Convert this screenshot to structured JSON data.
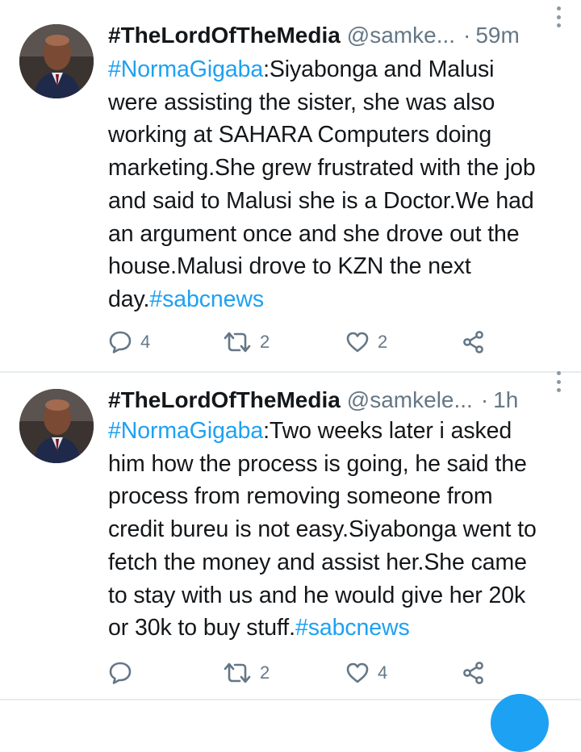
{
  "tweets": [
    {
      "name": "#TheLordOfTheMedia",
      "handle": "@samke...",
      "separator": "·",
      "time": "59m",
      "lines": [
        [
          {
            "t": "#NormaGigaba",
            "h": true
          },
          {
            "t": ":Siyabonga and Malusi",
            "h": false
          }
        ],
        [
          {
            "t": "were assisting the sister, she was also",
            "h": false
          }
        ],
        [
          {
            "t": "working at SAHARA Computers doing",
            "h": false
          }
        ],
        [
          {
            "t": "marketing.She grew frustrated with the job",
            "h": false
          }
        ],
        [
          {
            "t": "and said to Malusi she is a Doctor.We had",
            "h": false
          }
        ],
        [
          {
            "t": "an argument once and she drove out the",
            "h": false
          }
        ],
        [
          {
            "t": "house.Malusi drove to KZN the next",
            "h": false
          }
        ],
        [
          {
            "t": "day.",
            "h": false
          },
          {
            "t": "#sabcnews",
            "h": true
          }
        ]
      ],
      "reply_count": "4",
      "retweet_count": "2",
      "like_count": "2"
    },
    {
      "name": "#TheLordOfTheMedia",
      "handle": "@samkele...",
      "separator": "·",
      "time": "1h",
      "lines": [
        [
          {
            "t": "#NormaGigaba",
            "h": true
          },
          {
            "t": ":Two weeks later i asked",
            "h": false
          }
        ],
        [
          {
            "t": "him how the process is going, he said the",
            "h": false
          }
        ],
        [
          {
            "t": "process from removing someone from",
            "h": false
          }
        ],
        [
          {
            "t": "credit bureu is not easy.Siyabonga went to",
            "h": false
          }
        ],
        [
          {
            "t": "fetch the money and assist her.She came",
            "h": false
          }
        ],
        [
          {
            "t": "to stay with us and he would give her 20k",
            "h": false
          }
        ],
        [
          {
            "t": "or 30k to buy stuff.",
            "h": false
          },
          {
            "t": "#sabcnews",
            "h": true
          }
        ]
      ],
      "reply_count": "",
      "retweet_count": "2",
      "like_count": "4"
    }
  ],
  "icons": {
    "reply": "reply-icon",
    "retweet": "retweet-icon",
    "like": "heart-icon",
    "share": "share-icon",
    "more": "more-vertical-icon"
  },
  "colors": {
    "hashtag": "#1da1f2",
    "secondary_text": "#657786",
    "primary_text": "#14171a",
    "divider": "#e6ecf0",
    "icon": "#657786"
  }
}
